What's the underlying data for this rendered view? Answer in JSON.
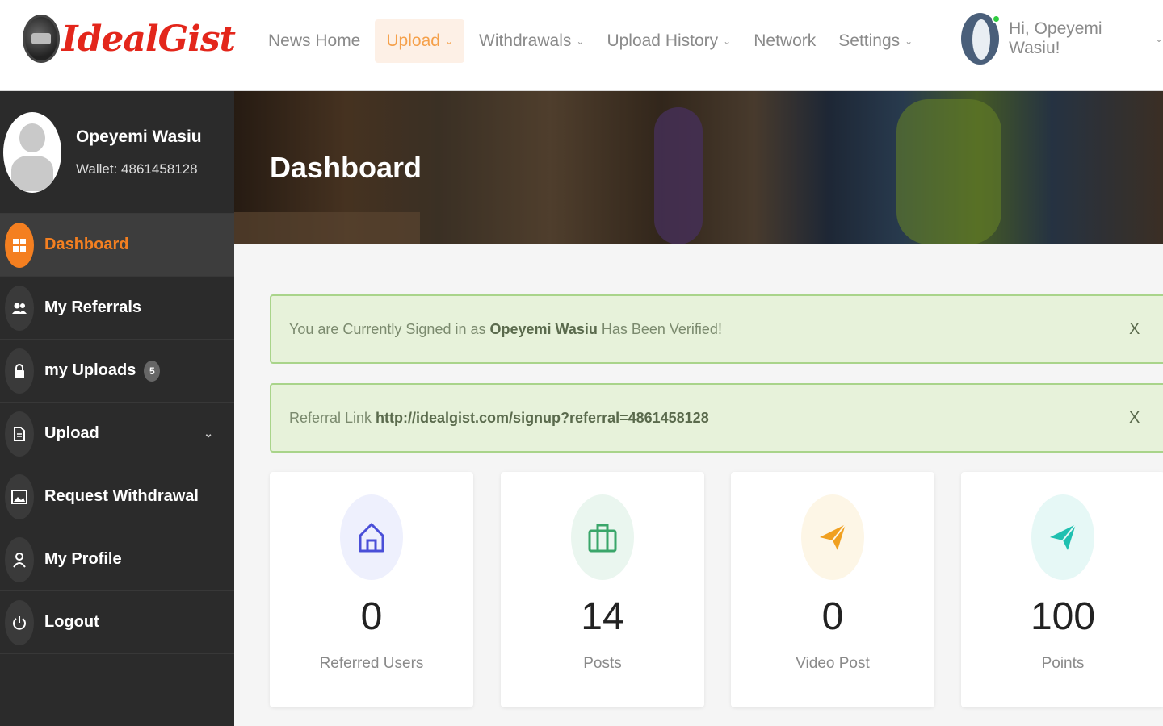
{
  "brand": {
    "logo_text": "IdealGist",
    "accent": "#f47f20",
    "logo_color": "#e3261b"
  },
  "nav": {
    "items": [
      {
        "label": "News Home",
        "dropdown": false
      },
      {
        "label": "Upload",
        "dropdown": true,
        "active": true
      },
      {
        "label": "Withdrawals",
        "dropdown": true
      },
      {
        "label": "Upload History",
        "dropdown": true
      },
      {
        "label": "Network",
        "dropdown": false
      },
      {
        "label": "Settings",
        "dropdown": true
      }
    ]
  },
  "user": {
    "greeting": "Hi, Opeyemi Wasiu!",
    "status": "online"
  },
  "sidebar": {
    "profile": {
      "name": "Opeyemi Wasiu",
      "wallet": "Wallet: 4861458128"
    },
    "items": [
      {
        "label": "Dashboard",
        "icon": "dashboard-icon",
        "active": true
      },
      {
        "label": "My Referrals",
        "icon": "users-icon"
      },
      {
        "label": "my Uploads",
        "icon": "lock-icon",
        "badge": "5"
      },
      {
        "label": "Upload",
        "icon": "file-icon",
        "expandable": true
      },
      {
        "label": "Request Withdrawal",
        "icon": "image-icon"
      },
      {
        "label": "My Profile",
        "icon": "user-icon"
      },
      {
        "label": "Logout",
        "icon": "power-icon"
      }
    ]
  },
  "banner": {
    "title": "Dashboard"
  },
  "alerts": {
    "verified": {
      "prefix": "You are Currently Signed in as",
      "name": "Opeyemi Wasiu",
      "suffix": "Has Been Verified!",
      "close": "X"
    },
    "referral": {
      "prefix": "Referral Link",
      "link": "http://idealgist.com/signup?referral=4861458128",
      "close": "X"
    }
  },
  "stats": [
    {
      "value": "0",
      "label": "Referred Users",
      "icon": "home-icon",
      "color": "#4a4fd8",
      "bg": "#eef0fd"
    },
    {
      "value": "14",
      "label": "Posts",
      "icon": "briefcase-icon",
      "color": "#3aa66a",
      "bg": "#eaf6ef"
    },
    {
      "value": "0",
      "label": "Video Post",
      "icon": "send-icon",
      "color": "#f0a020",
      "bg": "#fdf6e6"
    },
    {
      "value": "100",
      "label": "Points",
      "icon": "send-icon",
      "color": "#1fc0b0",
      "bg": "#e6f8f6"
    }
  ]
}
